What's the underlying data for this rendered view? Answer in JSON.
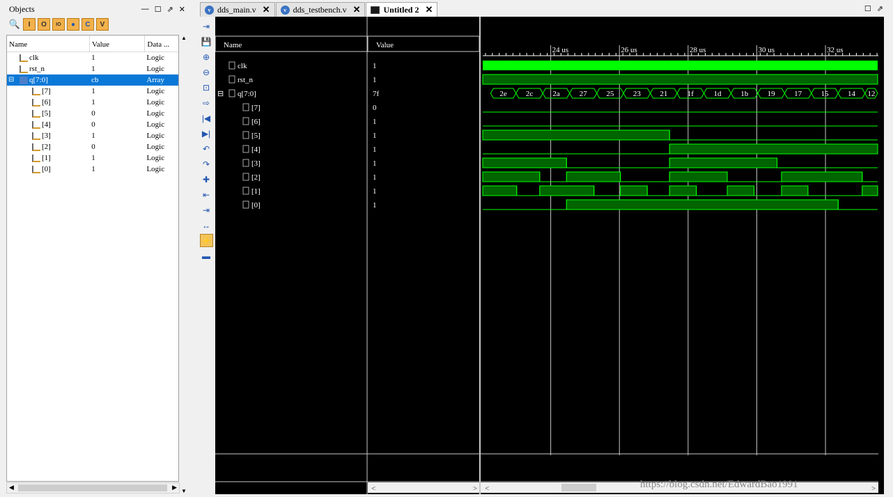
{
  "objects_panel": {
    "title": "Objects",
    "controls": [
      "—",
      "☐",
      "⇗",
      "✕"
    ],
    "toolbar_icons": [
      "search-icon",
      "input-icon",
      "output-icon",
      "inout-icon",
      "internal-icon",
      "constant-icon",
      "variable-icon"
    ],
    "toolbar_glyphs": [
      "🔍",
      "I",
      "O",
      "IO",
      "●",
      "C",
      "V"
    ],
    "columns": [
      "Name",
      "Value",
      "Data ..."
    ],
    "rows": [
      {
        "name": "clk",
        "value": "1",
        "type": "Logic",
        "level": 0,
        "expandable": false
      },
      {
        "name": "rst_n",
        "value": "1",
        "type": "Logic",
        "level": 0,
        "expandable": false
      },
      {
        "name": "q[7:0]",
        "value": "cb",
        "type": "Array",
        "level": 0,
        "expandable": true,
        "selected": true
      },
      {
        "name": "[7]",
        "value": "1",
        "type": "Logic",
        "level": 1
      },
      {
        "name": "[6]",
        "value": "1",
        "type": "Logic",
        "level": 1
      },
      {
        "name": "[5]",
        "value": "0",
        "type": "Logic",
        "level": 1
      },
      {
        "name": "[4]",
        "value": "0",
        "type": "Logic",
        "level": 1
      },
      {
        "name": "[3]",
        "value": "1",
        "type": "Logic",
        "level": 1
      },
      {
        "name": "[2]",
        "value": "0",
        "type": "Logic",
        "level": 1
      },
      {
        "name": "[1]",
        "value": "1",
        "type": "Logic",
        "level": 1
      },
      {
        "name": "[0]",
        "value": "1",
        "type": "Logic",
        "level": 1
      }
    ]
  },
  "tabs": [
    {
      "label": "dds_main.v",
      "icon": "verilog-file-icon",
      "active": false
    },
    {
      "label": "dds_testbench.v",
      "icon": "verilog-file-icon",
      "active": false
    },
    {
      "label": "Untitled 2",
      "icon": "waveform-icon",
      "active": true
    }
  ],
  "window_controls": [
    "☐",
    "⇗"
  ],
  "wave_toolbar": [
    "save-icon",
    "zoom-in-icon",
    "zoom-out-icon",
    "zoom-fit-icon",
    "go-to-cursor-icon",
    "go-to-start-icon",
    "go-to-end-icon",
    "previous-transition-icon",
    "next-transition-icon",
    "add-marker-icon",
    "previous-marker-icon",
    "next-marker-icon",
    "swap-cursors-icon",
    "snap-to-transition-icon",
    "floating-ruler-icon"
  ],
  "wave_toolbar_glyphs": [
    "⇥",
    "💾",
    "⊕",
    "⊖",
    "⊡",
    "⇨",
    "|◀",
    "▶|",
    "↶",
    "↷",
    "✚",
    "⇤",
    "⇥",
    "↔",
    "⚡",
    "▬"
  ],
  "wave_header": {
    "name": "Name",
    "value": "Value"
  },
  "ruler": {
    "labels": [
      "24 us",
      "26 us",
      "28 us",
      "30 us",
      "32 us"
    ],
    "times_us": [
      24,
      26,
      28,
      30,
      32
    ]
  },
  "signals": [
    {
      "name": "clk",
      "value": "1",
      "kind": "clock"
    },
    {
      "name": "rst_n",
      "value": "1",
      "kind": "high"
    },
    {
      "name": "q[7:0]",
      "value": "7f",
      "kind": "bus",
      "bus_values": [
        "2e",
        "2c",
        "2a",
        "27",
        "25",
        "23",
        "21",
        "1f",
        "1d",
        "1b",
        "19",
        "17",
        "15",
        "14",
        "12"
      ],
      "bus_times_us": [
        22.25,
        22.99,
        23.77,
        24.55,
        25.34,
        26.12,
        26.9,
        27.68,
        28.46,
        29.25,
        30.03,
        30.81,
        31.59,
        32.37,
        33.15
      ]
    },
    {
      "name": "[7]",
      "value": "0",
      "kind": "bit",
      "initial": 0,
      "transitions_us": []
    },
    {
      "name": "[6]",
      "value": "1",
      "kind": "bit",
      "initial": 0,
      "transitions_us": []
    },
    {
      "name": "[5]",
      "value": "1",
      "kind": "bit",
      "initial": 1,
      "transitions_us": [
        27.46
      ]
    },
    {
      "name": "[4]",
      "value": "1",
      "kind": "bit",
      "initial": 0,
      "transitions_us": [
        27.46
      ]
    },
    {
      "name": "[3]",
      "value": "1",
      "kind": "bit",
      "initial": 1,
      "transitions_us": [
        24.46,
        27.46,
        30.59
      ]
    },
    {
      "name": "[2]",
      "value": "1",
      "kind": "bit",
      "initial": 1,
      "transitions_us": [
        23.68,
        24.46,
        26.03,
        27.46,
        29.14,
        30.72,
        33.07
      ]
    },
    {
      "name": "[1]",
      "value": "1",
      "kind": "bit",
      "initial": 1,
      "transitions_us": [
        23.01,
        23.68,
        25.26,
        26.03,
        26.81,
        27.46,
        28.24,
        29.14,
        29.92,
        30.72,
        31.49,
        33.07
      ]
    },
    {
      "name": "[0]",
      "value": "1",
      "kind": "bit",
      "initial": 0,
      "transitions_us": [
        24.46,
        32.37
      ]
    }
  ],
  "view_range_us": [
    22.02,
    33.52
  ],
  "watermark": "https://blog.csdn.net/EdwardBao1991",
  "colors": {
    "waveform": "#00ff00",
    "bus_fill": "#006400",
    "selection": "#0a78d7",
    "background": "#000000"
  }
}
